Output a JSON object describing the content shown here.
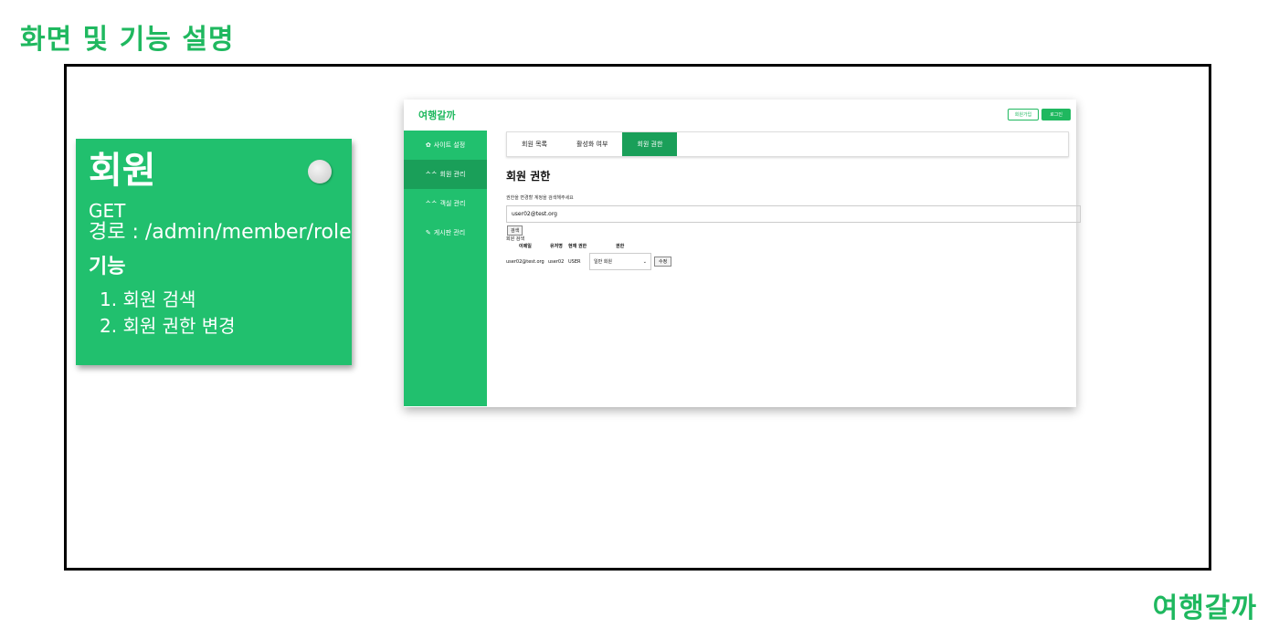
{
  "slide": {
    "title": "화면 및 기능 설명",
    "brand": "여행갈까"
  },
  "note": {
    "title": "회원",
    "method": "GET",
    "path": "경로 : /admin/member/role",
    "features_heading": "기능",
    "features": [
      "1. 회원 검색",
      "2. 회원 권한 변경"
    ]
  },
  "app": {
    "logo": "여행갈까",
    "header": {
      "signup": "회원가입",
      "login": "로그인"
    },
    "sidebar": [
      {
        "label": "사이트 설정",
        "icon": "gear-icon",
        "active": false
      },
      {
        "label": "회원 관리",
        "icon": "users-icon",
        "active": true
      },
      {
        "label": "객실 관리",
        "icon": "users-icon",
        "active": false
      },
      {
        "label": "게시판 관리",
        "icon": "pencil-icon",
        "active": false
      }
    ],
    "tabs": [
      "회원 목록",
      "활성화 여부",
      "회원 권한"
    ],
    "active_tab": 2,
    "page_title": "회원 권한",
    "search": {
      "hint": "권한을 변경할 계정을 검색해주세요",
      "value": "user02@test.org",
      "button": "검색"
    },
    "result": {
      "title": "회원 검색",
      "columns": [
        "이메일",
        "유저명",
        "현재 권한",
        "권한"
      ],
      "row": {
        "email": "user02@test.org",
        "username": "user02",
        "current_role": "USER",
        "role_select": "일반 회원",
        "edit_button": "수정"
      }
    },
    "accent_color": "#21c06e",
    "active_color": "#1a9f59"
  }
}
